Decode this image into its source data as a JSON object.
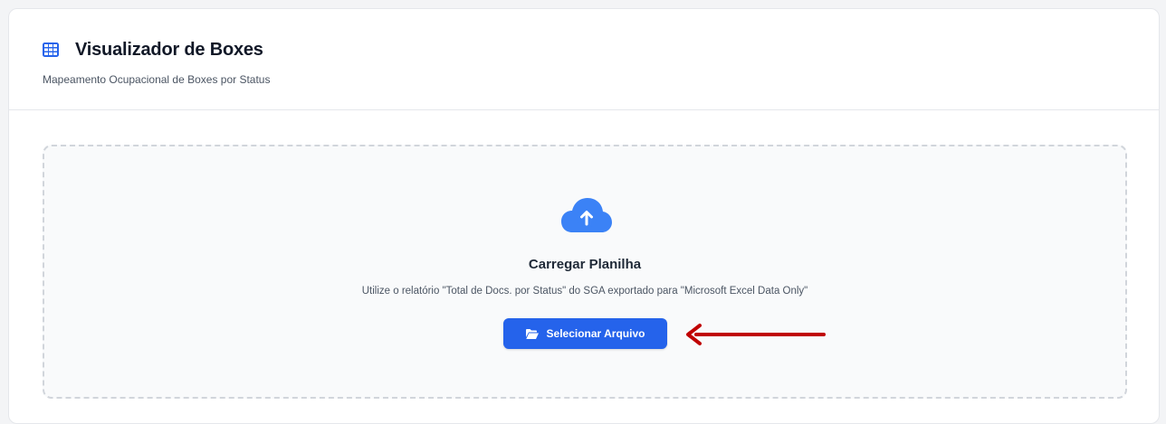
{
  "header": {
    "title": "Visualizador de Boxes",
    "subtitle": "Mapeamento Ocupacional de Boxes por Status",
    "icon": "table-grid-icon"
  },
  "upload": {
    "icon": "cloud-upload-icon",
    "title": "Carregar Planilha",
    "hint": "Utilize o relatório \"Total de Docs. por Status\" do SGA exportado para \"Microsoft Excel Data Only\"",
    "button_label": "Selecionar Arquivo",
    "button_icon": "folder-open-icon"
  },
  "annotation": {
    "icon": "red-arrow-left-icon"
  },
  "colors": {
    "accent": "#2563eb",
    "annotation": "#c00000",
    "background": "#f3f4f6",
    "dropzone_background": "#f9fafb"
  }
}
